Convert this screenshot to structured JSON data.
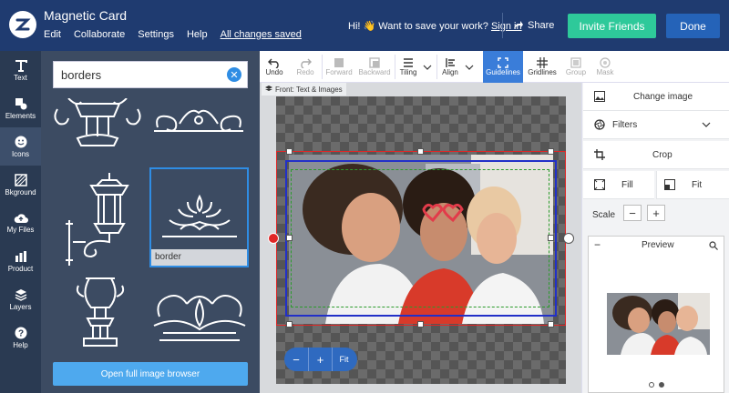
{
  "app": {
    "doc_title": "Magnetic Card",
    "menu": [
      "Edit",
      "Collaborate",
      "Settings",
      "Help"
    ],
    "saved_status": "All changes saved",
    "save_prompt": "Hi! 👋 Want to save your work?",
    "sign_in": "Sign in",
    "share_label": "Share",
    "invite_label": "Invite Friends",
    "done_label": "Done"
  },
  "sidebar": {
    "items": [
      {
        "label": "Text",
        "icon": "text-icon"
      },
      {
        "label": "Elements",
        "icon": "elements-icon"
      },
      {
        "label": "Icons",
        "icon": "smiley-icon"
      },
      {
        "label": "Bkground",
        "icon": "background-icon"
      },
      {
        "label": "My Files",
        "icon": "cloud-upload-icon"
      },
      {
        "label": "Product",
        "icon": "product-icon"
      },
      {
        "label": "Layers",
        "icon": "layers-icon"
      },
      {
        "label": "Help",
        "icon": "help-icon"
      }
    ]
  },
  "search": {
    "value": "borders",
    "selected_label": "border",
    "open_browser_label": "Open full image browser"
  },
  "toolbar": {
    "undo": "Undo",
    "redo": "Redo",
    "forward": "Forward",
    "backward": "Backward",
    "tiling": "Tiling",
    "align": "Align",
    "guidelines": "Guidelines",
    "gridlines": "Gridlines",
    "group": "Group",
    "mask": "Mask"
  },
  "canvas": {
    "breadcrumb": "Front: Text & Images",
    "zoom_minus": "−",
    "zoom_plus": "+",
    "zoom_fit": "Fit"
  },
  "right_panel": {
    "change_image": "Change image",
    "filters": "Filters",
    "crop": "Crop",
    "fill": "Fill",
    "fit": "Fit",
    "scale": "Scale",
    "preview_title": "Preview"
  },
  "colors": {
    "topbar": "#1f3b70",
    "invite": "#2ec99a",
    "done": "#2563b8",
    "accent": "#2f8de4"
  }
}
